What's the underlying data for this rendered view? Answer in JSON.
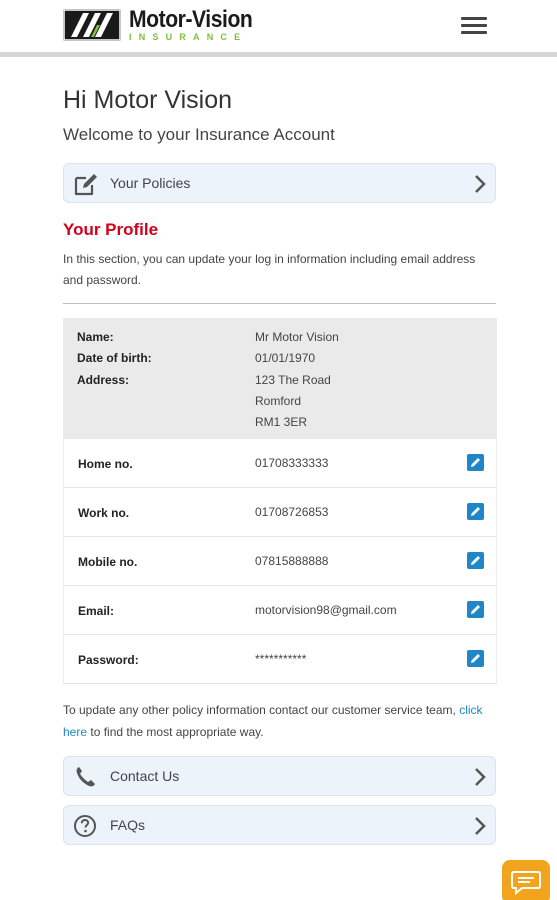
{
  "header": {
    "brand": "Motor-Vision",
    "brand_sub": "INSURANCE"
  },
  "greeting": "Hi Motor Vision",
  "welcome": "Welcome to your Insurance Account",
  "nav": {
    "policies": "Your Policies",
    "contact": "Contact Us",
    "faqs": "FAQs"
  },
  "profile": {
    "title": "Your Profile",
    "description": "In this section, you can update your log in information including email address and password.",
    "name_label": "Name:",
    "name_value": "Mr Motor Vision",
    "dob_label": "Date of birth:",
    "dob_value": "01/01/1970",
    "address_label": "Address:",
    "address_lines": [
      "123 The Road",
      "Romford",
      "RM1 3ER"
    ],
    "rows": [
      {
        "label": "Home no.",
        "value": "01708333333"
      },
      {
        "label": "Work no.",
        "value": "01708726853"
      },
      {
        "label": "Mobile no.",
        "value": "07815888888"
      },
      {
        "label": "Email:",
        "value": "motorvision98@gmail.com"
      },
      {
        "label": "Password:",
        "value": "***********"
      }
    ]
  },
  "footer": {
    "text_before": "To update any other policy information contact our customer service team,",
    "link": "click here",
    "text_after": "to find the most appropriate way."
  },
  "colors": {
    "accent_red": "#d0021b",
    "link_blue": "#1f86c8",
    "chat_orange": "#f2a41c",
    "brand_green": "#7dbf3c"
  },
  "icons": {
    "policies": "edit-document-icon",
    "contact": "phone-icon",
    "faqs": "question-circle-icon",
    "chevron": "chevron-right-icon",
    "edit": "pencil-icon",
    "chat": "chat-bubble-icon",
    "menu": "hamburger-menu-icon"
  }
}
